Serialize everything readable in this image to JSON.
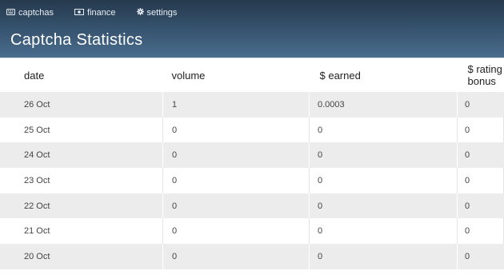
{
  "nav": {
    "items": [
      {
        "label": "captchas",
        "icon": "keyboard-icon"
      },
      {
        "label": "finance",
        "icon": "money-icon"
      },
      {
        "label": "settings",
        "icon": "gear-icon"
      }
    ]
  },
  "page": {
    "title": "Captcha Statistics"
  },
  "table": {
    "headers": [
      "date",
      "volume",
      "$ earned",
      "$ rating bonus"
    ],
    "rows": [
      [
        "26 Oct",
        "1",
        "0.0003",
        "0"
      ],
      [
        "25 Oct",
        "0",
        "0",
        "0"
      ],
      [
        "24 Oct",
        "0",
        "0",
        "0"
      ],
      [
        "23 Oct",
        "0",
        "0",
        "0"
      ],
      [
        "22 Oct",
        "0",
        "0",
        "0"
      ],
      [
        "21 Oct",
        "0",
        "0",
        "0"
      ],
      [
        "20 Oct",
        "0",
        "0",
        "0"
      ]
    ]
  },
  "colors": {
    "header_top": "#263a4d",
    "header_bottom": "#4a6d8e",
    "row_stripe": "#ececec"
  }
}
